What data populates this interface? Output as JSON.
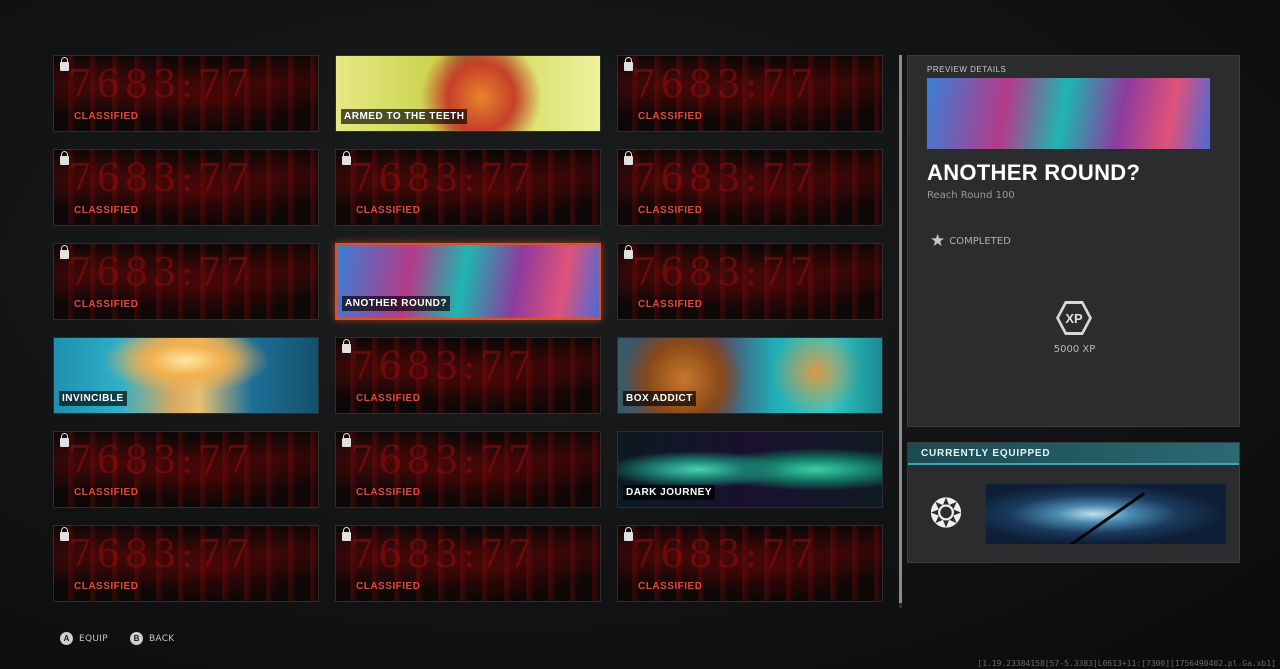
{
  "grid": {
    "cards": [
      {
        "label": "CLASSIFIED",
        "locked": true,
        "art": ""
      },
      {
        "label": "ARMED TO THE TEETH",
        "locked": false,
        "art": "art-armed"
      },
      {
        "label": "CLASSIFIED",
        "locked": true,
        "art": ""
      },
      {
        "label": "CLASSIFIED",
        "locked": true,
        "art": ""
      },
      {
        "label": "CLASSIFIED",
        "locked": true,
        "art": ""
      },
      {
        "label": "CLASSIFIED",
        "locked": true,
        "art": ""
      },
      {
        "label": "CLASSIFIED",
        "locked": true,
        "art": ""
      },
      {
        "label": "ANOTHER ROUND?",
        "locked": false,
        "art": "art-another",
        "selected": true
      },
      {
        "label": "CLASSIFIED",
        "locked": true,
        "art": ""
      },
      {
        "label": "INVINCIBLE",
        "locked": false,
        "art": "art-invincible"
      },
      {
        "label": "CLASSIFIED",
        "locked": true,
        "art": ""
      },
      {
        "label": "BOX ADDICT",
        "locked": false,
        "art": "art-box"
      },
      {
        "label": "CLASSIFIED",
        "locked": true,
        "art": ""
      },
      {
        "label": "CLASSIFIED",
        "locked": true,
        "art": ""
      },
      {
        "label": "DARK JOURNEY",
        "locked": false,
        "art": "art-dark"
      },
      {
        "label": "CLASSIFIED",
        "locked": true,
        "art": ""
      },
      {
        "label": "CLASSIFIED",
        "locked": true,
        "art": ""
      },
      {
        "label": "CLASSIFIED",
        "locked": true,
        "art": ""
      }
    ]
  },
  "preview": {
    "header": "PREVIEW DETAILS",
    "title": "ANOTHER ROUND?",
    "subtitle": "Reach Round 100",
    "status": "COMPLETED",
    "xp_badge": "XP",
    "xp_value": "5000 XP"
  },
  "equipped": {
    "header": "CURRENTLY EQUIPPED"
  },
  "footer": {
    "equip_button": "A",
    "equip_label": "EQUIP",
    "back_button": "B",
    "back_label": "BACK"
  },
  "build_string": "[1.19.23384158[57-5.3383]L0613+11:[7300][1756490402.pl.Ga.xb1]"
}
